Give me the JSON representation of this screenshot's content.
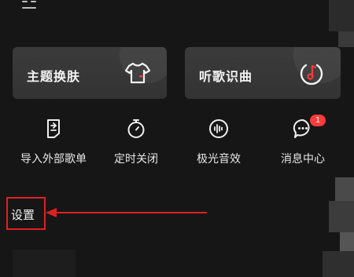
{
  "cards": [
    {
      "label": "主题换肤",
      "icon": "tshirt-icon"
    },
    {
      "label": "听歌识曲",
      "icon": "music-recognize-icon"
    }
  ],
  "actions": [
    {
      "label": "导入外部歌单",
      "icon": "import-playlist-icon"
    },
    {
      "label": "定时关闭",
      "icon": "timer-icon"
    },
    {
      "label": "极光音效",
      "icon": "sound-effect-icon"
    },
    {
      "label": "消息中心",
      "icon": "message-icon",
      "badge": "1"
    }
  ],
  "settings": {
    "label": "设置"
  },
  "colors": {
    "background": "#161616",
    "card": "#373737",
    "accent_red": "#e02020",
    "badge_red": "#ff3b3b"
  }
}
